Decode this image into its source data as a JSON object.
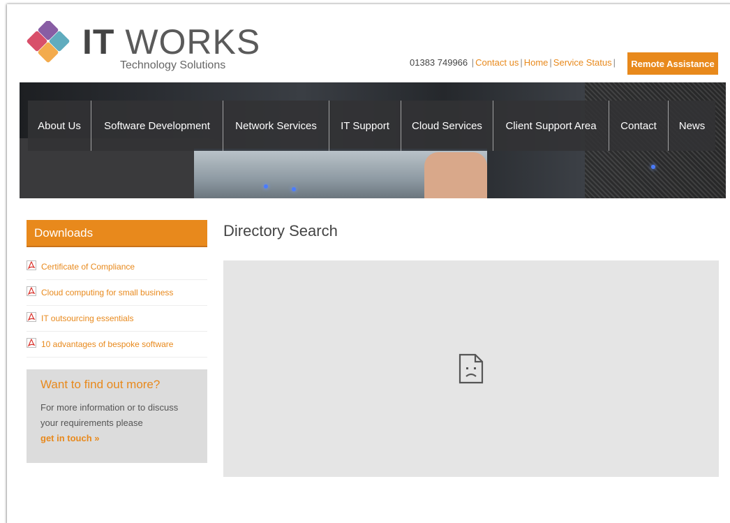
{
  "brand": {
    "name_bold": "IT",
    "name_light": "WORKS",
    "tagline": "Technology Solutions",
    "colors": [
      "#7b4b9a",
      "#4fa3b7",
      "#d43c5a",
      "#f2a23a"
    ]
  },
  "toplinks": {
    "phone": "01383 749966",
    "contact": "Contact us",
    "home": "Home",
    "status": "Service Status",
    "separator": "|"
  },
  "remote_button": "Remote Assistance",
  "nav": [
    {
      "label": "About Us"
    },
    {
      "label": "Software Development"
    },
    {
      "label": "Network Services"
    },
    {
      "label": "IT Support"
    },
    {
      "label": "Cloud Services"
    },
    {
      "label": "Client Support Area"
    },
    {
      "label": "Contact"
    },
    {
      "label": "News"
    }
  ],
  "sidebar": {
    "downloads_title": "Downloads",
    "downloads": [
      {
        "label": "Certificate of Compliance",
        "icon": "pdf-icon"
      },
      {
        "label": "Cloud computing for small business",
        "icon": "pdf-icon"
      },
      {
        "label": "IT outsourcing essentials",
        "icon": "pdf-icon"
      },
      {
        "label": "10 advantages of bespoke software",
        "icon": "pdf-icon"
      }
    ],
    "cta": {
      "title": "Want to find out more?",
      "body": "For more information or to discuss your requirements please",
      "link": "get in touch »"
    }
  },
  "main": {
    "title": "Directory Search",
    "frame_icon": "broken-page-icon"
  },
  "accent_color": "#e8891c"
}
